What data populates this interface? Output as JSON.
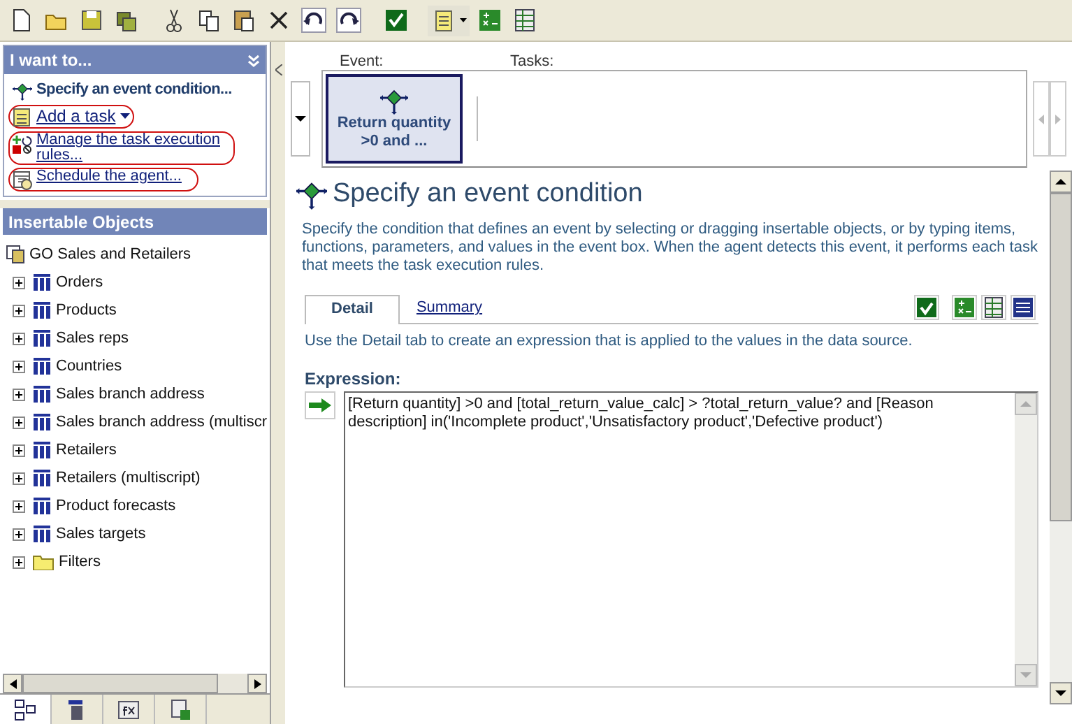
{
  "task_pane": {
    "title": "I want to...",
    "items": [
      {
        "kind": "heading",
        "label": "Specify an event condition...",
        "circled": false
      },
      {
        "kind": "link",
        "label": "Add a task",
        "dropdown": true,
        "circled": true
      },
      {
        "kind": "link",
        "label": "Manage the task execution rules...",
        "dropdown": false,
        "circled": true
      },
      {
        "kind": "link",
        "label": "Schedule the agent...",
        "dropdown": false,
        "circled": true
      }
    ]
  },
  "insertable_objects": {
    "title": "Insertable Objects",
    "tree": [
      {
        "label": "GO Sales and Retailers",
        "kind": "package",
        "children": [
          {
            "label": "Orders",
            "kind": "query_subject",
            "expanded": false
          },
          {
            "label": "Products",
            "kind": "query_subject",
            "expanded": false
          },
          {
            "label": "Sales reps",
            "kind": "query_subject",
            "expanded": false
          },
          {
            "label": "Countries",
            "kind": "query_subject",
            "expanded": false
          },
          {
            "label": "Sales branch address",
            "kind": "query_subject",
            "expanded": false
          },
          {
            "label": "Sales branch address (multiscr",
            "kind": "query_subject",
            "expanded": false
          },
          {
            "label": "Retailers",
            "kind": "query_subject",
            "expanded": false
          },
          {
            "label": "Retailers (multiscript)",
            "kind": "query_subject",
            "expanded": false
          },
          {
            "label": "Product forecasts",
            "kind": "query_subject",
            "expanded": false
          },
          {
            "label": "Sales targets",
            "kind": "query_subject",
            "expanded": false
          },
          {
            "label": "Filters",
            "kind": "folder",
            "expanded": false
          }
        ]
      }
    ],
    "bottom_tabs": [
      {
        "kind": "source",
        "selected": true
      },
      {
        "kind": "data_items",
        "selected": false
      },
      {
        "kind": "functions",
        "selected": false
      },
      {
        "kind": "parameters",
        "selected": false
      }
    ]
  },
  "event_strip": {
    "event_label": "Event:",
    "tasks_label": "Tasks:",
    "event": {
      "label": "Return quantity >0 and ...",
      "selected": true
    }
  },
  "main": {
    "title": "Specify an event condition",
    "description": "Specify the condition that defines an event by selecting or dragging insertable objects, or by typing items, functions, parameters, and values in the event box. When the agent detects this event, it performs each task that meets the task execution rules.",
    "tabs": [
      {
        "label": "Detail",
        "selected": true
      },
      {
        "label": "Summary",
        "selected": false
      }
    ],
    "hint": "Use the Detail tab to create an expression that is applied to the values in the data source.",
    "expression_label": "Expression:",
    "expression": "[Return quantity] >0 and [total_return_value_calc] > ?total_return_value? and [Reason description] in('Incomplete product','Unsatisfactory product','Defective product')"
  }
}
